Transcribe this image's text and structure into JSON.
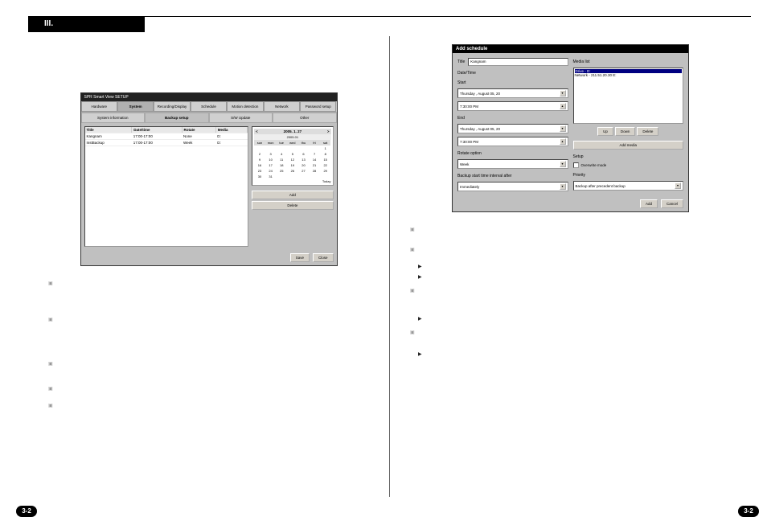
{
  "section_number": "III.",
  "page_number": "3-2",
  "setup_window": {
    "title": "SPR Smart View SETUP",
    "tabs": [
      "Hardware",
      "System",
      "Recording/Display",
      "Schedule",
      "Motion detection",
      "Network",
      "Password setup"
    ],
    "active_tab": "System",
    "subtabs": [
      "System information",
      "Backup setup",
      "S/W Update",
      "Other"
    ],
    "active_subtab": "Backup setup",
    "table": {
      "headers": [
        "Title",
        "Date/time",
        "Rotate",
        "Media"
      ],
      "rows": [
        [
          "Kangnam",
          "17:00-17:00",
          "None",
          "D:"
        ],
        [
          "InstBackup",
          "17:00-17:00",
          "Week",
          "D:"
        ]
      ]
    },
    "calendar": {
      "header_left": "<",
      "header_date": "2005. 1. 27",
      "header_right": ">",
      "sub": "2005.01",
      "days": [
        "sun",
        "mon",
        "tue",
        "wed",
        "thu",
        "fri",
        "sat"
      ],
      "grid": [
        "",
        "",
        "",
        "",
        "",
        "",
        "1",
        "2",
        "3",
        "4",
        "5",
        "6",
        "7",
        "8",
        "9",
        "10",
        "11",
        "12",
        "13",
        "14",
        "15",
        "16",
        "17",
        "18",
        "19",
        "20",
        "21",
        "22",
        "23",
        "24",
        "25",
        "26",
        "27",
        "28",
        "29",
        "30",
        "31",
        "",
        "",
        "",
        "",
        ""
      ],
      "footnote": "Today"
    },
    "add_btn": "Add",
    "delete_btn": "Delete",
    "save_btn": "Save",
    "close_btn": "Close"
  },
  "dialog": {
    "title": "Add schedule",
    "title_label": "Title",
    "title_value": "Kangnam",
    "datetime_label": "Date/Time",
    "start_label": "Start",
    "start_date": "Thursday , August  05, 20",
    "start_time": "7:30:00 PM",
    "end_label": "End",
    "end_date": "Thursday , August  05, 20",
    "end_time": "7:30:00 PM",
    "rotate_label": "Rotate option",
    "rotate_value": "Week",
    "backup_start_label": "Backup start time interval after",
    "backup_start_value": "Immediately",
    "media_label": "Media list",
    "media_items": [
      "Drive - D:",
      "Network - 211.51.20.30 E:"
    ],
    "up_btn": "Up",
    "down_btn": "Down",
    "delete_btn": "Delete",
    "addmedia_btn": "Add media",
    "setup_label": "Setup",
    "overwrite_label": "Overwrite mode",
    "priority_label": "Priority",
    "priority_value": "Backup after precedent backup",
    "add_btn": "Add",
    "cancel_btn": "Cancel"
  }
}
